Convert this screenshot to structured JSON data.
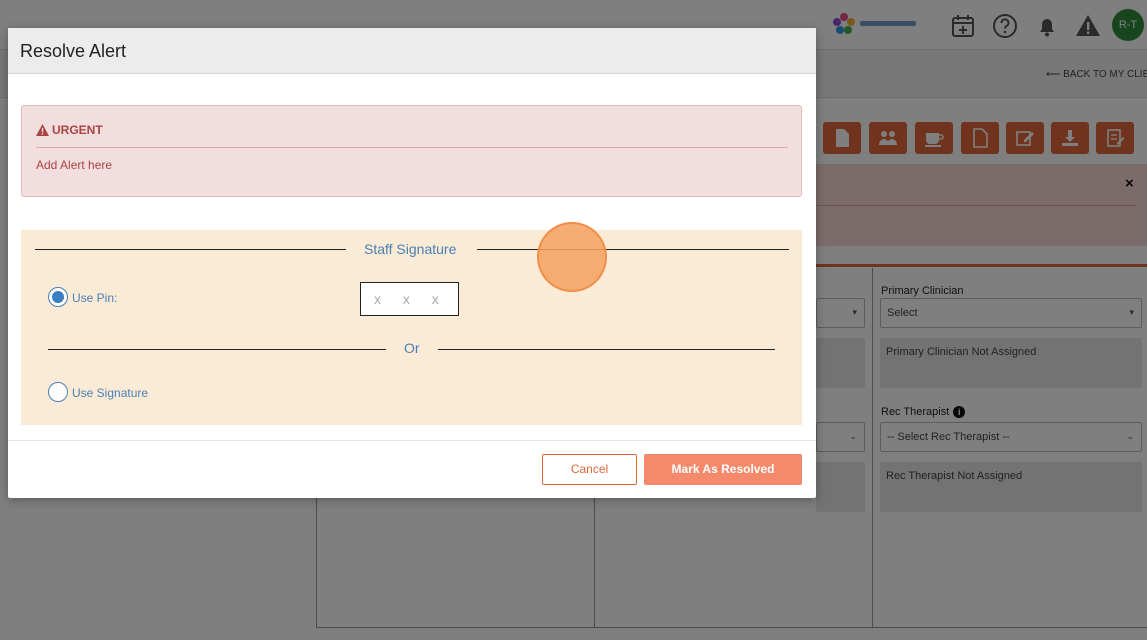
{
  "background": {
    "back_link": "⟵ BACK TO MY CLIE",
    "alert_close": "×",
    "primary_clinician": {
      "label": "Primary Clinician",
      "select_value": "Select",
      "status": "Primary Clinician Not Assigned"
    },
    "rec_therapist": {
      "label": "Rec Therapist",
      "info": "i",
      "select_value": "-- Select Rec Therapist --",
      "status": "Rec Therapist Not Assigned"
    },
    "avatar_initials": "R-T"
  },
  "modal": {
    "title": "Resolve Alert",
    "urgent": {
      "title": "URGENT",
      "text": "Add Alert here"
    },
    "signature": {
      "title": "Staff Signature",
      "use_pin_label": "Use Pin:",
      "pin_placeholder": "x x x x",
      "or_label": "Or",
      "use_signature_label": "Use Signature"
    },
    "buttons": {
      "cancel": "Cancel",
      "resolve": "Mark As Resolved"
    }
  },
  "colors": {
    "accent": "#e0663d",
    "urgent_text": "#a94442",
    "link_blue": "#4a7fb5"
  }
}
